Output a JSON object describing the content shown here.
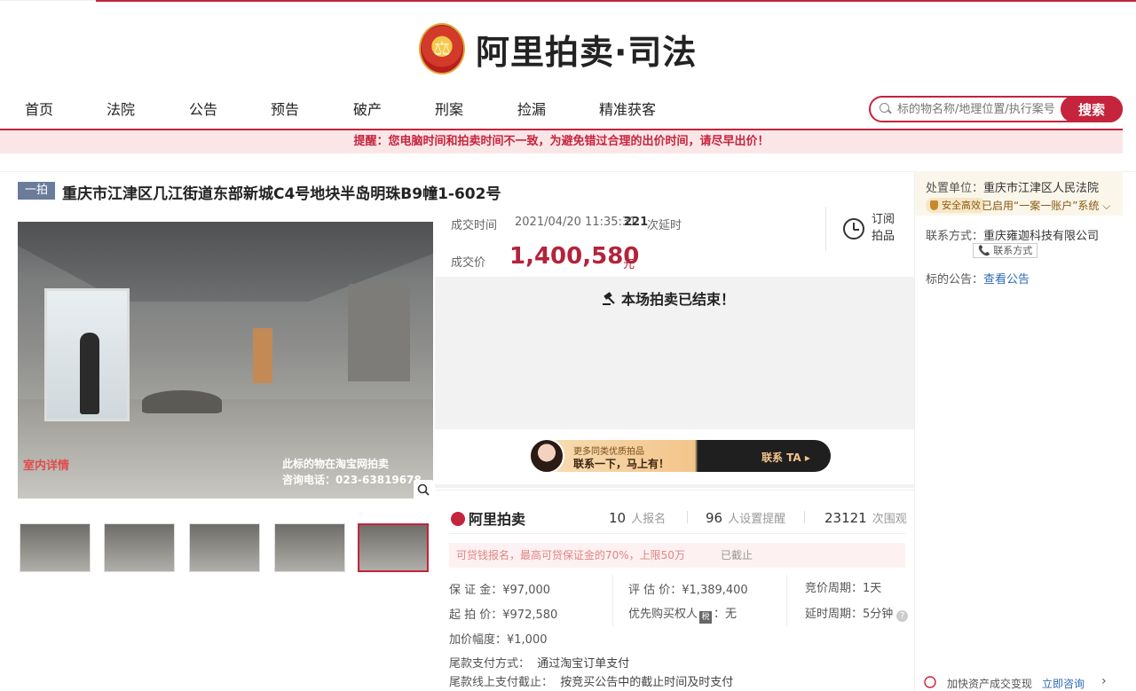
{
  "logo": {
    "emblem": "⚖",
    "text": "阿里拍卖·司法"
  },
  "nav": [
    "首页",
    "法院",
    "公告",
    "预告",
    "破产",
    "刑案",
    "捡漏",
    "精准获客"
  ],
  "search": {
    "placeholder": "标的物名称/地理位置/执行案号",
    "button": "搜索"
  },
  "notice": "提醒：您电脑时间和拍卖时间不一致，为避免错过合理的出价时间，请尽早出价！",
  "lot": {
    "tag": "一拍",
    "title": "重庆市江津区几江街道东部新城C4号地块半岛明珠B9幢1-602号",
    "photo_caption_left": "室内详情",
    "photo_caption_right_1": "此标的物在淘宝网拍卖",
    "photo_caption_right_2": "咨询电话：023-63819678"
  },
  "deal": {
    "time_label": "成交时间",
    "time_value": "2021/04/20 11:35:31",
    "delay_count": "221",
    "delay_text": "次延时",
    "subscribe_1": "订阅",
    "subscribe_2": "拍品",
    "price_label": "成交价",
    "price_value": "1,400,580",
    "price_unit": "元",
    "ended": "本场拍卖已结束！"
  },
  "banner": {
    "small": "更多同类优质拍品",
    "big": "联系一下，马上有！",
    "cta": "联系 TA ▸"
  },
  "stats": {
    "brand": "阿里拍卖",
    "signup_count": "10",
    "signup_label": "人报名",
    "remind_count": "96",
    "remind_label": "人设置提醒",
    "view_count": "23121",
    "view_label": "次围观"
  },
  "deposit_note": {
    "text": "可贷钱报名，最高可贷保证金的70%，上限50万",
    "status": "已截止"
  },
  "info": {
    "deposit": "保 证 金：¥97,000",
    "appraisal": "评 估 价：¥1,389,400",
    "period": "竞价周期：1天",
    "start": "起 拍 价：¥972,580",
    "priority_label": "优先购买权人",
    "priority_badge": "税",
    "priority_value": "：无",
    "extend": "延时周期：5分钟",
    "increment": "加价幅度：¥1,000",
    "pay_method_label": "尾款支付方式：",
    "pay_method_value": "通过淘宝订单支付",
    "pay_deadline_label": "尾款线上支付截止：",
    "pay_deadline_value": "按竞买公告中的截止时间及时支付"
  },
  "right": {
    "unit_label": "处置单位：",
    "unit_value": "重庆市江津区人民法院",
    "safe_badge": "安全高效",
    "system_text": "已启用“一案一账户”系统 ⌵",
    "contact_label": "联系方式：",
    "contact_value": "重庆雍迦科技有限公司",
    "contact_button": "📞 联系方式",
    "notice_label": "标的公告：",
    "notice_link": "查看公告",
    "bottom_text": "加快资产成交变现",
    "bottom_link": "立即咨询",
    "bottom_arrow": "›"
  },
  "colors": {
    "brand_red": "#c5243d",
    "price_red": "#b3233b",
    "link_blue": "#2f6ab5"
  }
}
